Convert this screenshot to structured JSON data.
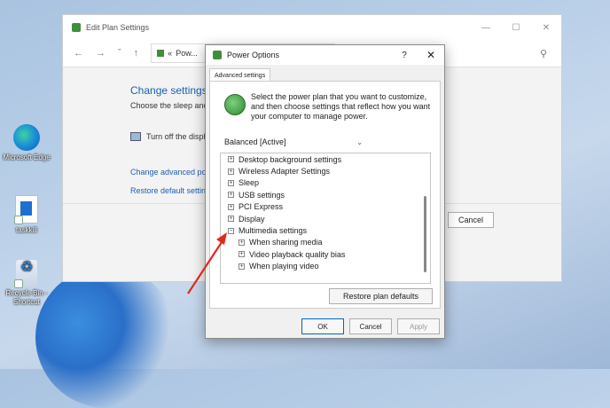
{
  "desktop": {
    "icons": [
      {
        "label": "Microsoft Edge",
        "icon": "edge-icon"
      },
      {
        "label": "taskkill",
        "icon": "file-icon"
      },
      {
        "label": "Recycle Bin - Shortcut",
        "icon": "recycle-bin-icon"
      }
    ]
  },
  "background_window": {
    "title": "Edit Plan Settings",
    "controls": [
      "—",
      "☐",
      "✕"
    ],
    "address_segment": "Pow...",
    "heading": "Change settings",
    "subtext": "Choose the sleep anc",
    "turnoff_label": "Turn off the displ",
    "link_advanced": "Change advanced po",
    "link_restore": "Restore default settin",
    "cancel_label": "Cancel"
  },
  "dialog": {
    "title": "Power Options",
    "help": "?",
    "close": "✕",
    "tab_label": "Advanced settings",
    "intro": "Select the power plan that you want to customize, and then choose settings that reflect how you want your computer to manage power.",
    "plan_selected": "Balanced [Active]",
    "tree": [
      {
        "label": "Desktop background settings",
        "expanded": false,
        "level": 0
      },
      {
        "label": "Wireless Adapter Settings",
        "expanded": false,
        "level": 0
      },
      {
        "label": "Sleep",
        "expanded": false,
        "level": 0
      },
      {
        "label": "USB settings",
        "expanded": false,
        "level": 0
      },
      {
        "label": "PCI Express",
        "expanded": false,
        "level": 0
      },
      {
        "label": "Display",
        "expanded": false,
        "level": 0
      },
      {
        "label": "Multimedia settings",
        "expanded": true,
        "level": 0
      },
      {
        "label": "When sharing media",
        "expanded": false,
        "level": 1
      },
      {
        "label": "Video playback quality bias",
        "expanded": false,
        "level": 1
      },
      {
        "label": "When playing video",
        "expanded": false,
        "level": 1
      }
    ],
    "restore_label": "Restore plan defaults",
    "ok_label": "OK",
    "cancel_label": "Cancel",
    "apply_label": "Apply"
  },
  "annotation": {
    "color": "#e0281e"
  }
}
